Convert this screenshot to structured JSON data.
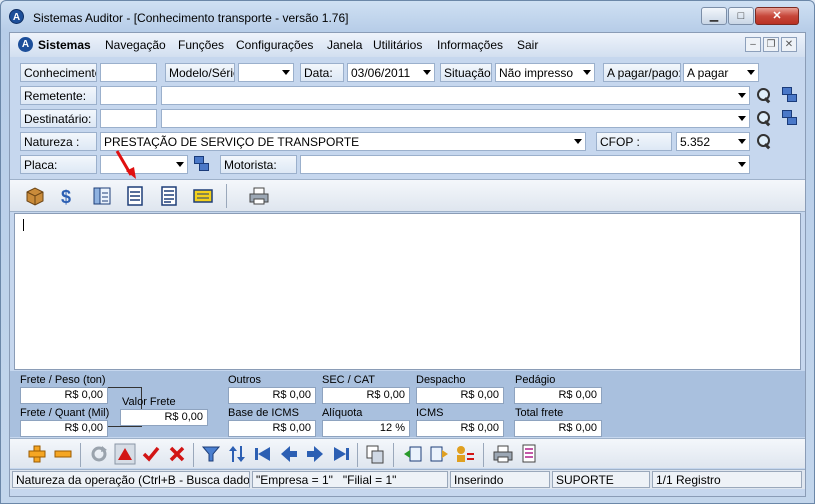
{
  "window": {
    "title": "Sistemas Auditor - [Conhecimento transporte - versão 1.76]",
    "logo_letter": "A",
    "min": "▁",
    "max": "□",
    "close": "✕"
  },
  "menubar": {
    "items": [
      "Sistemas",
      "Navegação",
      "Funções",
      "Configurações",
      "Janela",
      "Utilitários",
      "Informações",
      "Sair"
    ],
    "mdi_min": "–",
    "mdi_restore": "❐",
    "mdi_close": "✕"
  },
  "form": {
    "conhecimento": {
      "label": "Conhecimento:",
      "value": ""
    },
    "modelo": {
      "label": "Modelo/Série:",
      "value": ""
    },
    "data": {
      "label": "Data:",
      "value": "03/06/2011"
    },
    "situacao": {
      "label": "Situação:",
      "value": "Não impresso"
    },
    "apagar": {
      "label": "A pagar/pago:",
      "value": "A pagar"
    },
    "remetente": {
      "label": "Remetente:",
      "code": "",
      "name": ""
    },
    "destinatario": {
      "label": "Destinatário:",
      "code": "",
      "name": ""
    },
    "natureza": {
      "label": "Natureza :",
      "value": "PRESTAÇÃO DE SERVIÇO DE TRANSPORTE"
    },
    "cfop": {
      "label": "CFOP :",
      "value": "5.352"
    },
    "placa": {
      "label": "Placa:",
      "value": ""
    },
    "motorista": {
      "label": "Motorista:",
      "value": ""
    }
  },
  "toolbar1": [
    "package-icon",
    "money-icon",
    "notes-icon",
    "document-icon",
    "document-lines-icon",
    "invoice-icon",
    "printer-icon"
  ],
  "totals": {
    "frete_peso": {
      "label": "Frete / Peso (ton)",
      "value": "R$ 0,00"
    },
    "frete_quant": {
      "label": "Frete / Quant (Mil)",
      "value": "R$ 0,00"
    },
    "valor_frete": {
      "label": "Valor Frete",
      "value": "R$ 0,00"
    },
    "outros": {
      "label": "Outros",
      "value": "R$ 0,00"
    },
    "base_icms": {
      "label": "Base de ICMS",
      "value": "R$ 0,00"
    },
    "sec_cat": {
      "label": "SEC / CAT",
      "value": "R$ 0,00"
    },
    "aliquota": {
      "label": "Alíquota",
      "value": "12 %"
    },
    "despacho": {
      "label": "Despacho",
      "value": "R$ 0,00"
    },
    "icms": {
      "label": "ICMS",
      "value": "R$ 0,00"
    },
    "pedagio": {
      "label": "Pedágio",
      "value": "R$ 0,00"
    },
    "total_frete": {
      "label": "Total frete",
      "value": "R$ 0,00"
    }
  },
  "statusbar": {
    "hint": "Natureza da operação (Ctrl+B - Busca dados",
    "context": "\"Empresa = 1\"   \"Filial = 1\"",
    "mode": "Inserindo",
    "user": "SUPORTE",
    "records": "1/1 Registro"
  },
  "colors": {
    "accent": "#1d4f9a",
    "annotation_arrow": "#e01010",
    "totals_bg": "#a9c0de"
  }
}
